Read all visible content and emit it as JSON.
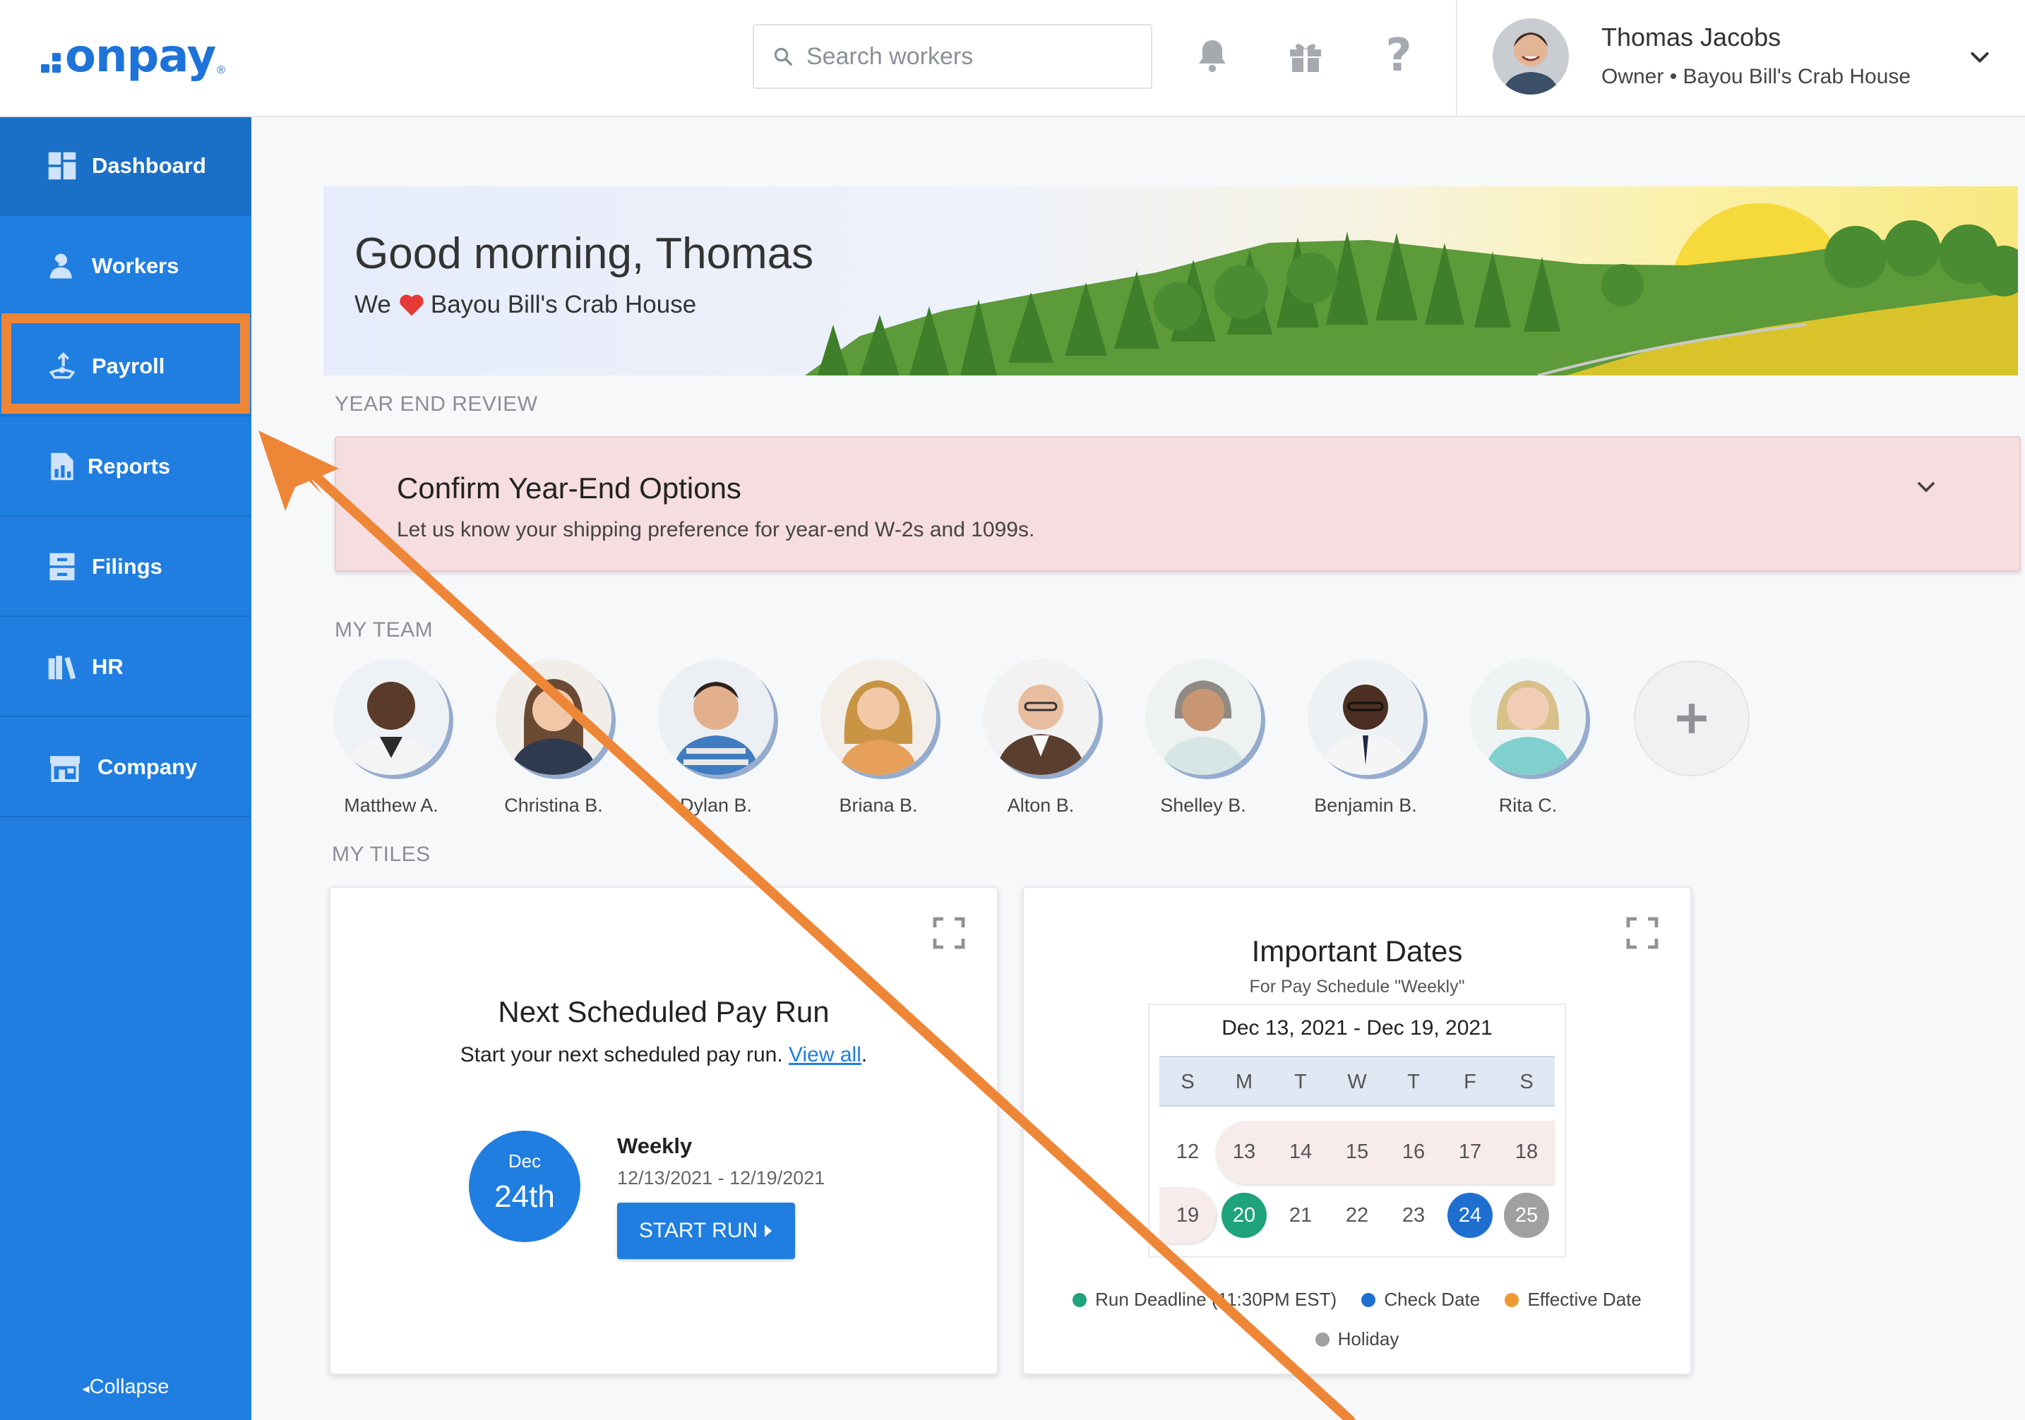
{
  "header": {
    "logo_text": "onpay",
    "logo_mark": "®",
    "search_placeholder": "Search workers",
    "user_name": "Thomas Jacobs",
    "user_role": "Owner • Bayou Bill's Crab House"
  },
  "sidebar": {
    "items": [
      {
        "label": "Dashboard",
        "icon": "dashboard-icon"
      },
      {
        "label": "Workers",
        "icon": "workers-icon"
      },
      {
        "label": "Payroll",
        "icon": "payroll-icon"
      },
      {
        "label": "Reports",
        "icon": "reports-icon"
      },
      {
        "label": "Filings",
        "icon": "filings-icon"
      },
      {
        "label": "HR",
        "icon": "hr-icon"
      },
      {
        "label": "Company",
        "icon": "company-icon"
      }
    ],
    "active": "Dashboard",
    "highlighted": "Payroll",
    "collapse_label": "Collapse"
  },
  "banner": {
    "greeting": "Good morning, Thomas",
    "we": "We",
    "company": "Bayou Bill's Crab House"
  },
  "year_end": {
    "section_label": "YEAR END REVIEW",
    "title": "Confirm Year-End Options",
    "description": "Let us know your shipping preference for year-end W-2s and 1099s."
  },
  "team": {
    "section_label": "MY TEAM",
    "members": [
      "Matthew A.",
      "Christina B.",
      "Dylan B.",
      "Briana B.",
      "Alton B.",
      "Shelley B.",
      "Benjamin B.",
      "Rita C."
    ]
  },
  "tiles": {
    "section_label": "MY TILES",
    "pay_run": {
      "title": "Next Scheduled Pay Run",
      "subtitle": "Start your next scheduled pay run.",
      "link": "View all",
      "period": ".",
      "month": "Dec",
      "day": "24th",
      "frequency": "Weekly",
      "range": "12/13/2021 - 12/19/2021",
      "button": "START RUN"
    },
    "important_dates": {
      "title": "Important Dates",
      "subtitle": "For Pay Schedule \"Weekly\"",
      "week_range": "Dec 13, 2021 - Dec 19, 2021",
      "weekdays": [
        "S",
        "M",
        "T",
        "W",
        "T",
        "F",
        "S"
      ],
      "row1": [
        "12",
        "13",
        "14",
        "15",
        "16",
        "17",
        "18"
      ],
      "row2": [
        "19",
        "20",
        "21",
        "22",
        "23",
        "24",
        "25"
      ],
      "legend": {
        "run_deadline": "Run Deadline (11:30PM EST)",
        "check_date": "Check Date",
        "effective_date": "Effective Date",
        "holiday": "Holiday"
      },
      "colors": {
        "run_deadline": "#1ea37a",
        "check_date": "#1f6fd0",
        "effective_date": "#ee9a32",
        "holiday": "#a0a0a0"
      }
    }
  },
  "colors": {
    "brand": "#1f7ee0",
    "annotation": "#ee8637"
  }
}
